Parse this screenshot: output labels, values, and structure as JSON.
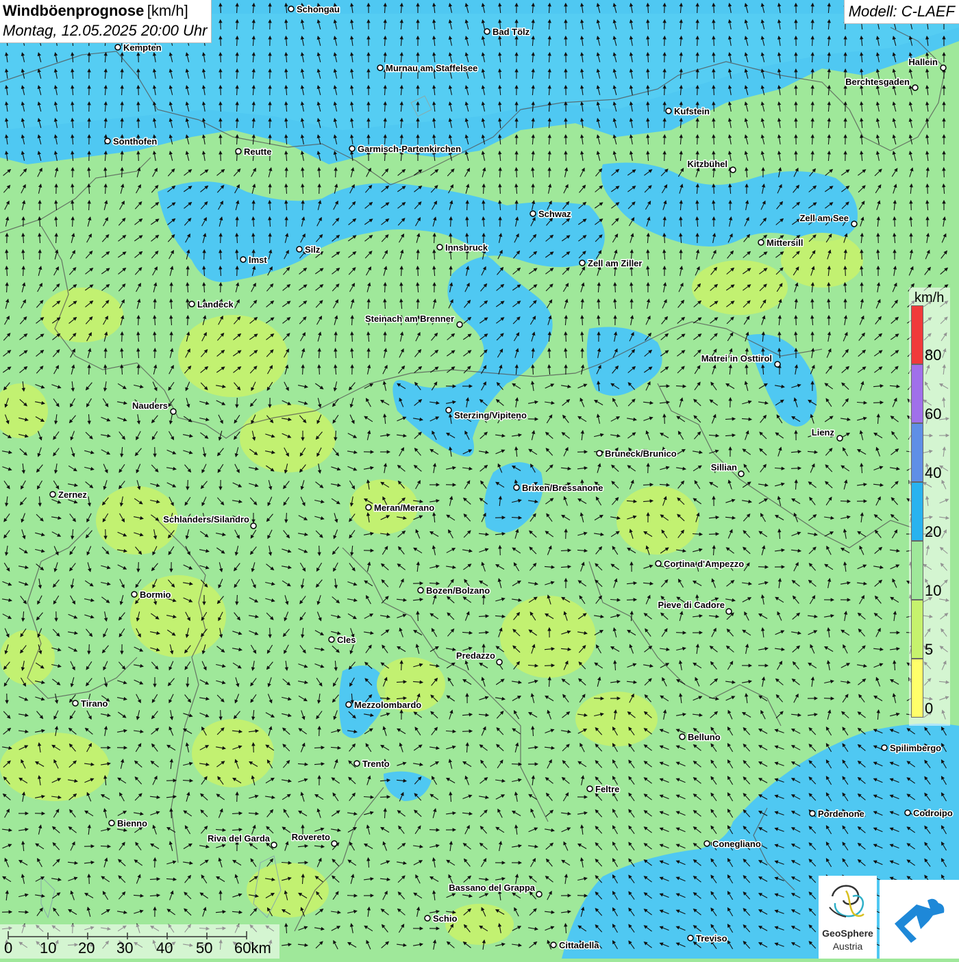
{
  "title": {
    "main": "Windböenprognose",
    "unit": "[km/h]",
    "datetime": "Montag, 12.05.2025 20:00 Uhr"
  },
  "model": "Modell: C-LAEF",
  "colors": {
    "c0": "#ffff6a",
    "c5": "#c6f26d",
    "c10": "#9fe89a",
    "c20": "#4fc3f0",
    "c40": "#5f8fe6",
    "c60": "#a070ea",
    "c80": "#f03a3a"
  },
  "legend": {
    "unit": "km/h",
    "labels": [
      "80",
      "60",
      "40",
      "20",
      "10",
      "5",
      "0"
    ],
    "bands": [
      {
        "range": "80+",
        "color": "#f03a3a"
      },
      {
        "range": "60-80",
        "color": "#a070ea"
      },
      {
        "range": "40-60",
        "color": "#5f8fe6"
      },
      {
        "range": "20-40",
        "color": "#29b3ef"
      },
      {
        "range": "10-20",
        "color": "#9fe89a"
      },
      {
        "range": "5-10",
        "color": "#c6f26d"
      },
      {
        "range": "0-5",
        "color": "#ffff6a"
      }
    ]
  },
  "scale": {
    "labels": [
      "0",
      "10",
      "20",
      "30",
      "40",
      "50",
      "60km"
    ]
  },
  "logo": {
    "name": "GeoSphere",
    "sub": "Austria"
  },
  "cities": [
    "Schongau",
    "Bad Tölz",
    "Kempten",
    "Murnau am Staffelsee",
    "Hallein",
    "Berchtesgaden",
    "Kufstein",
    "Sonthofen",
    "Reutte",
    "Garmisch-Partenkirchen",
    "Kitzbühel",
    "Schwaz",
    "Zell am See",
    "Innsbruck",
    "Mittersill",
    "Imst",
    "Silz",
    "Zell am Ziller",
    "Landeck",
    "Steinach am Brenner",
    "Matrei in Osttirol",
    "Nauders",
    "Sterzing/Vipiteno",
    "Lienz",
    "Bruneck/Brunico",
    "Sillian",
    "Brixen/Bressanone",
    "Zernez",
    "Meran/Merano",
    "Schlanders/Silandro",
    "Cortina d'Ampezzo",
    "Bozen/Bolzano",
    "Bormio",
    "Pieve di Cadore",
    "Cles",
    "Predazzo",
    "Tirano",
    "Mezzolombardo",
    "Belluno",
    "Spilimbergo",
    "Trento",
    "Feltre",
    "Pordenone",
    "Codroipo",
    "Bienno",
    "Riva del Garda",
    "Rovereto",
    "Conegliano",
    "Bassano del Grappa",
    "Schio",
    "Treviso",
    "Cittadella"
  ]
}
